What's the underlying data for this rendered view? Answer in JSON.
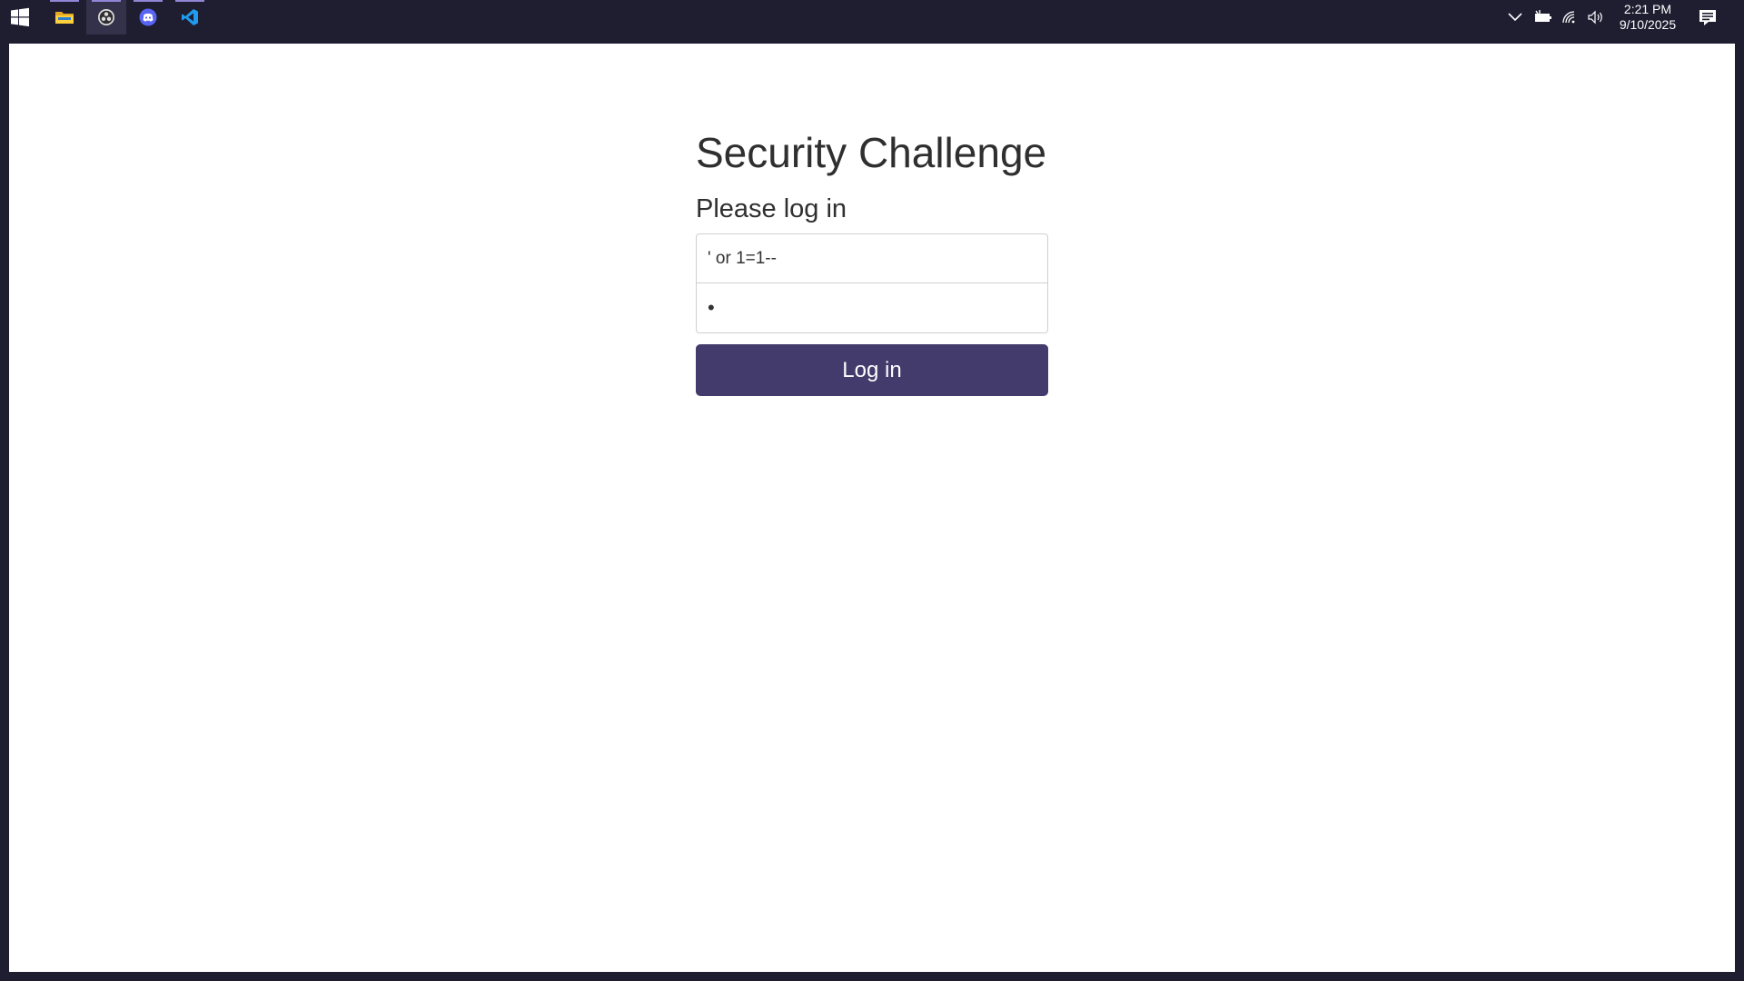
{
  "taskbar": {
    "apps": [
      {
        "name": "File Explorer",
        "icon": "folder-icon"
      },
      {
        "name": "OBS Studio",
        "icon": "obs-icon"
      },
      {
        "name": "Discord",
        "icon": "discord-icon"
      },
      {
        "name": "Visual Studio Code",
        "icon": "vscode-icon"
      }
    ],
    "clock": {
      "time": "2:21 PM",
      "date": "9/10/2025"
    }
  },
  "page": {
    "title": "Security Challenge",
    "subtitle": "Please log in",
    "username_value": "' or 1=1--",
    "password_value": "x",
    "login_label": "Log in"
  },
  "colors": {
    "taskbar_bg": "#1f1d30",
    "button_bg": "#433b6c",
    "page_bg": "#ffffff"
  }
}
